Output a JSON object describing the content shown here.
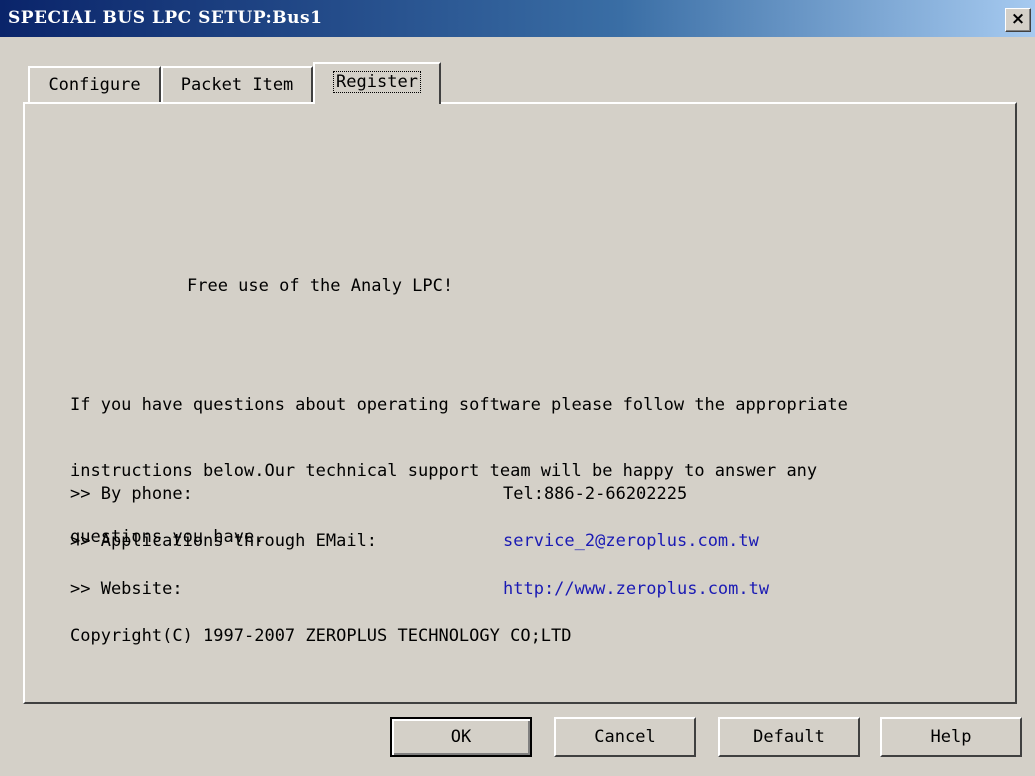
{
  "window": {
    "title": "SPECIAL BUS LPC SETUP:Bus1",
    "close_label": "×"
  },
  "tabs": [
    {
      "label": "Configure",
      "selected": false
    },
    {
      "label": "Packet Item",
      "selected": false
    },
    {
      "label": "Register",
      "selected": true
    }
  ],
  "register": {
    "free_use": "Free use of the Analy LPC!",
    "intro_lines": [
      "If you have questions about operating software please follow the appropriate",
      "instructions below.Our technical support team will be happy to answer any",
      "questions you have."
    ],
    "contacts": [
      {
        "label": ">> By phone:",
        "value": "Tel:886-2-66202225"
      },
      {
        "label": ">> Applications through EMail:",
        "value": "service_2@zeroplus.com.tw"
      },
      {
        "label": ">> Website:",
        "value": "http://www.zeroplus.com.tw"
      }
    ],
    "copyright": "Copyright(C) 1997-2007 ZEROPLUS TECHNOLOGY CO;LTD"
  },
  "buttons": {
    "ok": "OK",
    "cancel": "Cancel",
    "default": "Default",
    "help": "Help"
  },
  "colors": {
    "title_gradient_start": "#0a246a",
    "title_gradient_end": "#a6caf0",
    "link": "#1a1ab4",
    "face": "#d4d0c8"
  }
}
